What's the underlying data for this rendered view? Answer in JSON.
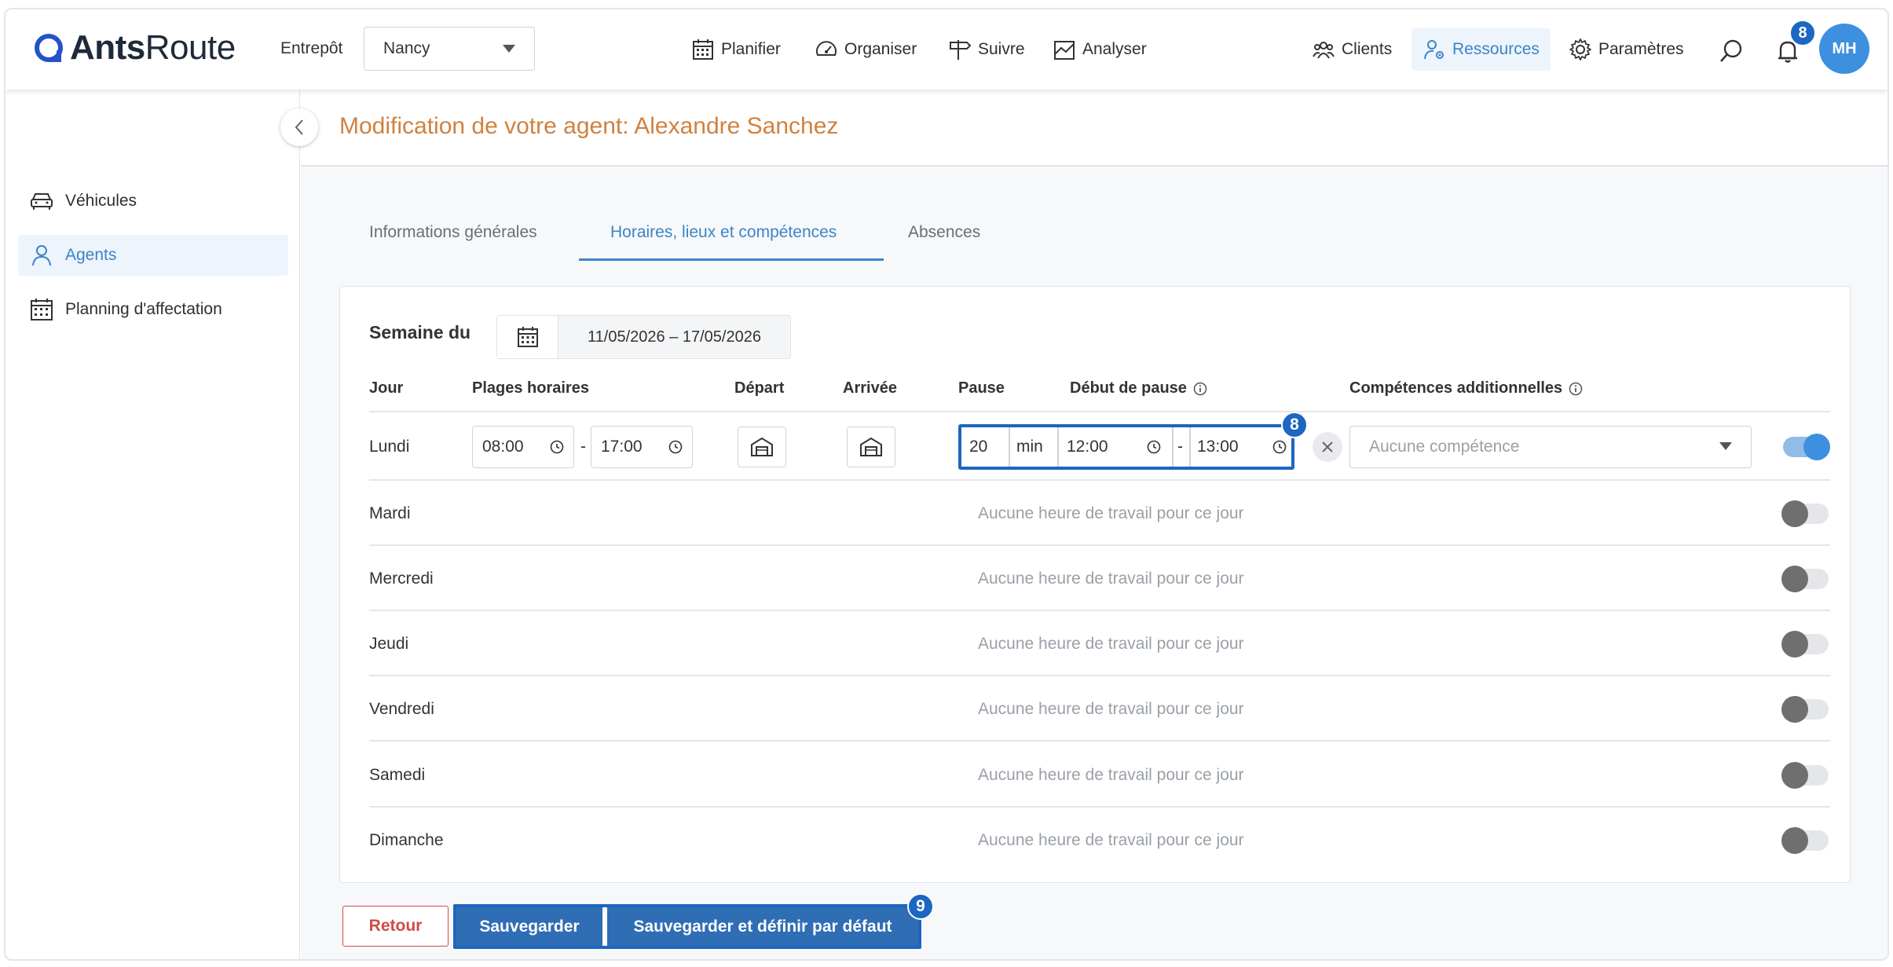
{
  "header": {
    "logo_bold": "Ants",
    "logo_light": "Route",
    "warehouse_label": "Entrepôt",
    "warehouse_value": "Nancy",
    "nav": {
      "plan": "Planifier",
      "organize": "Organiser",
      "track": "Suivre",
      "analyze": "Analyser"
    },
    "right_nav": {
      "clients": "Clients",
      "resources": "Ressources",
      "settings": "Paramètres"
    },
    "notification_count": "8",
    "avatar_initials": "MH"
  },
  "sidebar": {
    "items": [
      {
        "label": "Véhicules",
        "icon": "car-icon"
      },
      {
        "label": "Agents",
        "icon": "person-icon"
      },
      {
        "label": "Planning d'affectation",
        "icon": "calendar-icon"
      }
    ]
  },
  "page": {
    "title": "Modification de votre agent: Alexandre Sanchez",
    "tabs": [
      "Informations générales",
      "Horaires, lieux et compétences",
      "Absences"
    ],
    "active_tab": 1
  },
  "schedule": {
    "week_label": "Semaine du",
    "week_range": "11/05/2026 – 17/05/2026",
    "columns": {
      "day": "Jour",
      "slots": "Plages horaires",
      "departure": "Départ",
      "arrival": "Arrivée",
      "pause": "Pause",
      "pause_start": "Début de pause",
      "skills": "Compétences additionnelles"
    },
    "monday": {
      "day": "Lundi",
      "start": "08:00",
      "end": "17:00",
      "pause_value": "20",
      "pause_unit": "min",
      "pause_from": "12:00",
      "pause_to": "13:00",
      "skills_placeholder": "Aucune compétence",
      "enabled": true
    },
    "no_work_text": "Aucune heure de travail pour ce jour",
    "other_days": [
      "Mardi",
      "Mercredi",
      "Jeudi",
      "Vendredi",
      "Samedi",
      "Dimanche"
    ],
    "step_markers": {
      "pause": "8",
      "save": "9"
    }
  },
  "actions": {
    "back": "Retour",
    "save": "Sauvegarder",
    "save_default": "Sauvegarder et définir par défaut"
  },
  "colors": {
    "accent": "#3c84c8",
    "title": "#d0813f",
    "primary_button": "#2f6db5",
    "danger": "#cf4d45",
    "highlight": "#1d66c1"
  }
}
